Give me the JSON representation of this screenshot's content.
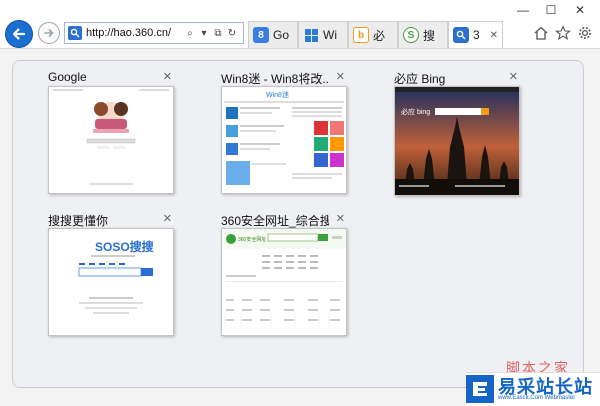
{
  "browser": {
    "address_url": "http://hao.360.cn/",
    "tabs": [
      {
        "label": "Go",
        "icon": "google-favicon",
        "icon_text": "8",
        "color": "#3b7de0",
        "active": false
      },
      {
        "label": "Wi",
        "icon": "windows-favicon",
        "icon_text": "",
        "color": "#2f7bd3",
        "active": false
      },
      {
        "label": "必",
        "icon": "bing-favicon",
        "icon_text": "b",
        "color": "#f29a1a",
        "active": false
      },
      {
        "label": "搜",
        "icon": "soso-favicon",
        "icon_text": "S",
        "color": "#3aa13a",
        "active": false
      },
      {
        "label": "3",
        "icon": "360-favicon",
        "icon_text": "",
        "color": "#2a6fd1",
        "active": true
      }
    ],
    "window_controls": [
      "—",
      "☐",
      "✕"
    ]
  },
  "tiles": [
    {
      "title": "Google",
      "close": "✕"
    },
    {
      "title": "Win8迷 - Win8将改...",
      "close": "✕"
    },
    {
      "title": "必应 Bing",
      "close": "✕"
    },
    {
      "title": "搜搜更懂你",
      "close": "✕"
    },
    {
      "title": "360安全网址_综合搜...",
      "close": "✕"
    }
  ],
  "thumbnails": {
    "win8_logo": "Win8迷",
    "soso_logo": "SOSO搜搜",
    "bing_logo": "必应 bing",
    "nav360_logo": "360安全网址"
  },
  "watermark": {
    "red_text": "脚本之家",
    "brand": "易采站长站",
    "sub": "www.Easck.Com Webmaster"
  },
  "colors": {
    "accent": "#1a6fd0",
    "panel_bg": "#eef0f3"
  }
}
